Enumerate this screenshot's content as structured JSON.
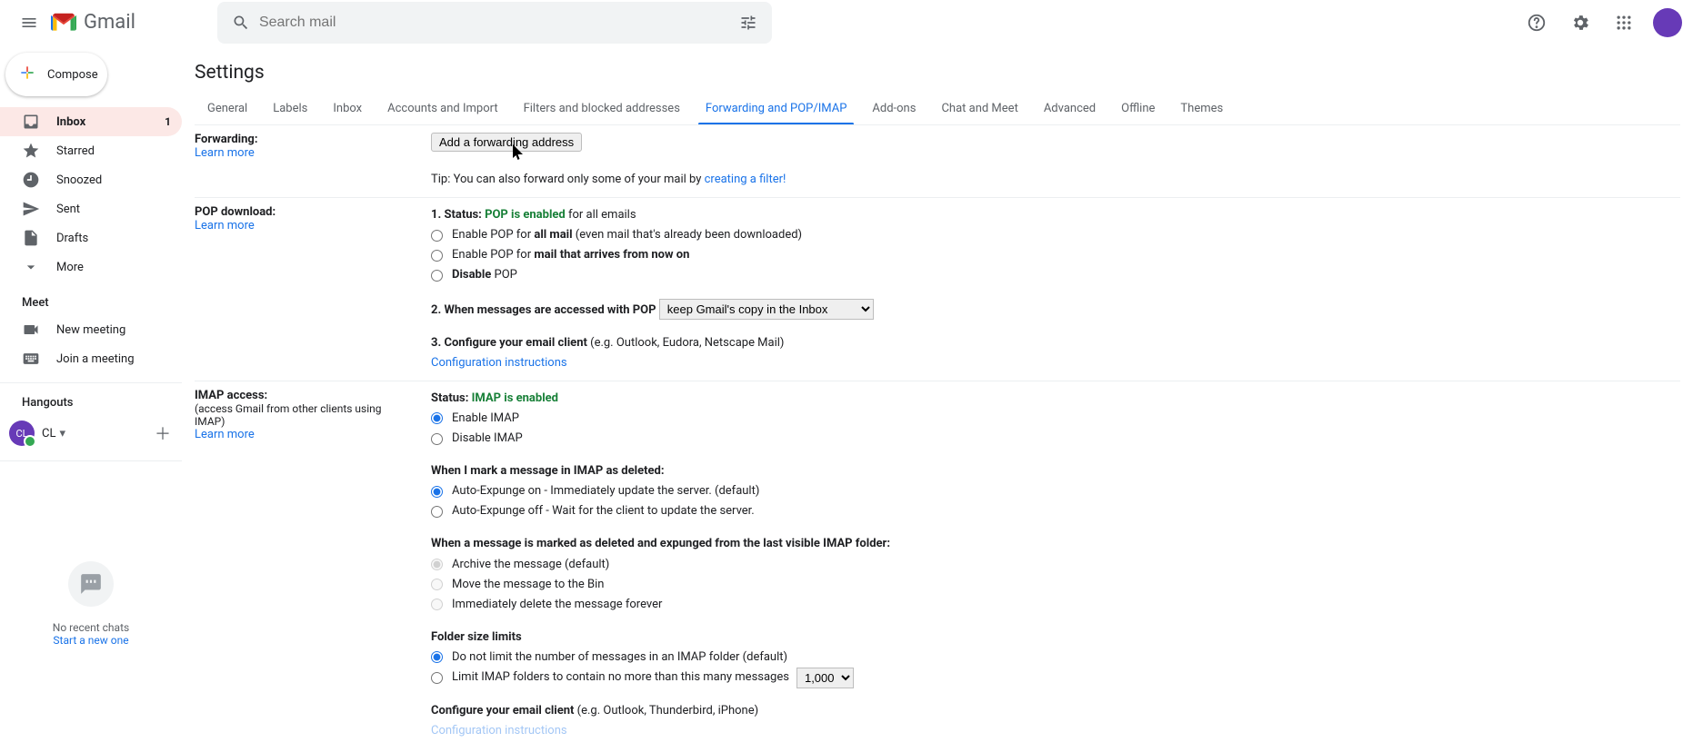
{
  "header": {
    "product": "Gmail",
    "search_placeholder": "Search mail"
  },
  "sidebar": {
    "compose": "Compose",
    "items": [
      {
        "label": "Inbox",
        "count": "1"
      },
      {
        "label": "Starred"
      },
      {
        "label": "Snoozed"
      },
      {
        "label": "Sent"
      },
      {
        "label": "Drafts"
      },
      {
        "label": "More"
      }
    ],
    "meet_label": "Meet",
    "meet_new": "New meeting",
    "meet_join": "Join a meeting",
    "hangouts_label": "Hangouts",
    "hangouts_user_initials": "CL",
    "hangouts_user_short": "CL",
    "no_chats": "No recent chats",
    "start_new": "Start a new one"
  },
  "page_title": "Settings",
  "tabs": [
    "General",
    "Labels",
    "Inbox",
    "Accounts and Import",
    "Filters and blocked addresses",
    "Forwarding and POP/IMAP",
    "Add-ons",
    "Chat and Meet",
    "Advanced",
    "Offline",
    "Themes"
  ],
  "active_tab_index": 5,
  "forwarding": {
    "label": "Forwarding:",
    "learn_more": "Learn more",
    "add_btn": "Add a forwarding address",
    "tip_prefix": "Tip: You can also forward only some of your mail by ",
    "tip_link": "creating a filter!"
  },
  "pop": {
    "label": "POP download:",
    "learn_more": "Learn more",
    "status_prefix": "1. Status: ",
    "status_value": "POP is enabled",
    "status_suffix": " for all emails",
    "opt1_pre": "Enable POP for ",
    "opt1_bold": "all mail",
    "opt1_suf": " (even mail that's already been downloaded)",
    "opt2_pre": "Enable POP for ",
    "opt2_bold": "mail that arrives from now on",
    "opt3_bold": "Disable",
    "opt3_suf": " POP",
    "when_label": "2. When messages are accessed with POP ",
    "when_value": "keep Gmail's copy in the Inbox",
    "config_label": "3. Configure your email client",
    "config_eg": " (e.g. Outlook, Eudora, Netscape Mail)",
    "config_link": "Configuration instructions"
  },
  "imap": {
    "label": "IMAP access:",
    "sub": "(access Gmail from other clients using IMAP)",
    "learn_more": "Learn more",
    "status_prefix": "Status: ",
    "status_value": "IMAP is enabled",
    "enable": "Enable IMAP",
    "disable": "Disable IMAP",
    "deleted_title": "When I mark a message in IMAP as deleted:",
    "expunge_on": "Auto-Expunge on - Immediately update the server. (default)",
    "expunge_off": "Auto-Expunge off - Wait for the client to update the server.",
    "expunged_title": "When a message is marked as deleted and expunged from the last visible IMAP folder:",
    "archive": "Archive the message (default)",
    "move_bin": "Move the message to the Bin",
    "delete_forever": "Immediately delete the message forever",
    "folder_title": "Folder size limits",
    "no_limit": "Do not limit the number of messages in an IMAP folder (default)",
    "limit": "Limit IMAP folders to contain no more than this many messages ",
    "limit_value": "1,000",
    "config_label": "Configure your email client",
    "config_eg": " (e.g. Outlook, Thunderbird, iPhone)",
    "config_link": "Configuration instructions"
  }
}
